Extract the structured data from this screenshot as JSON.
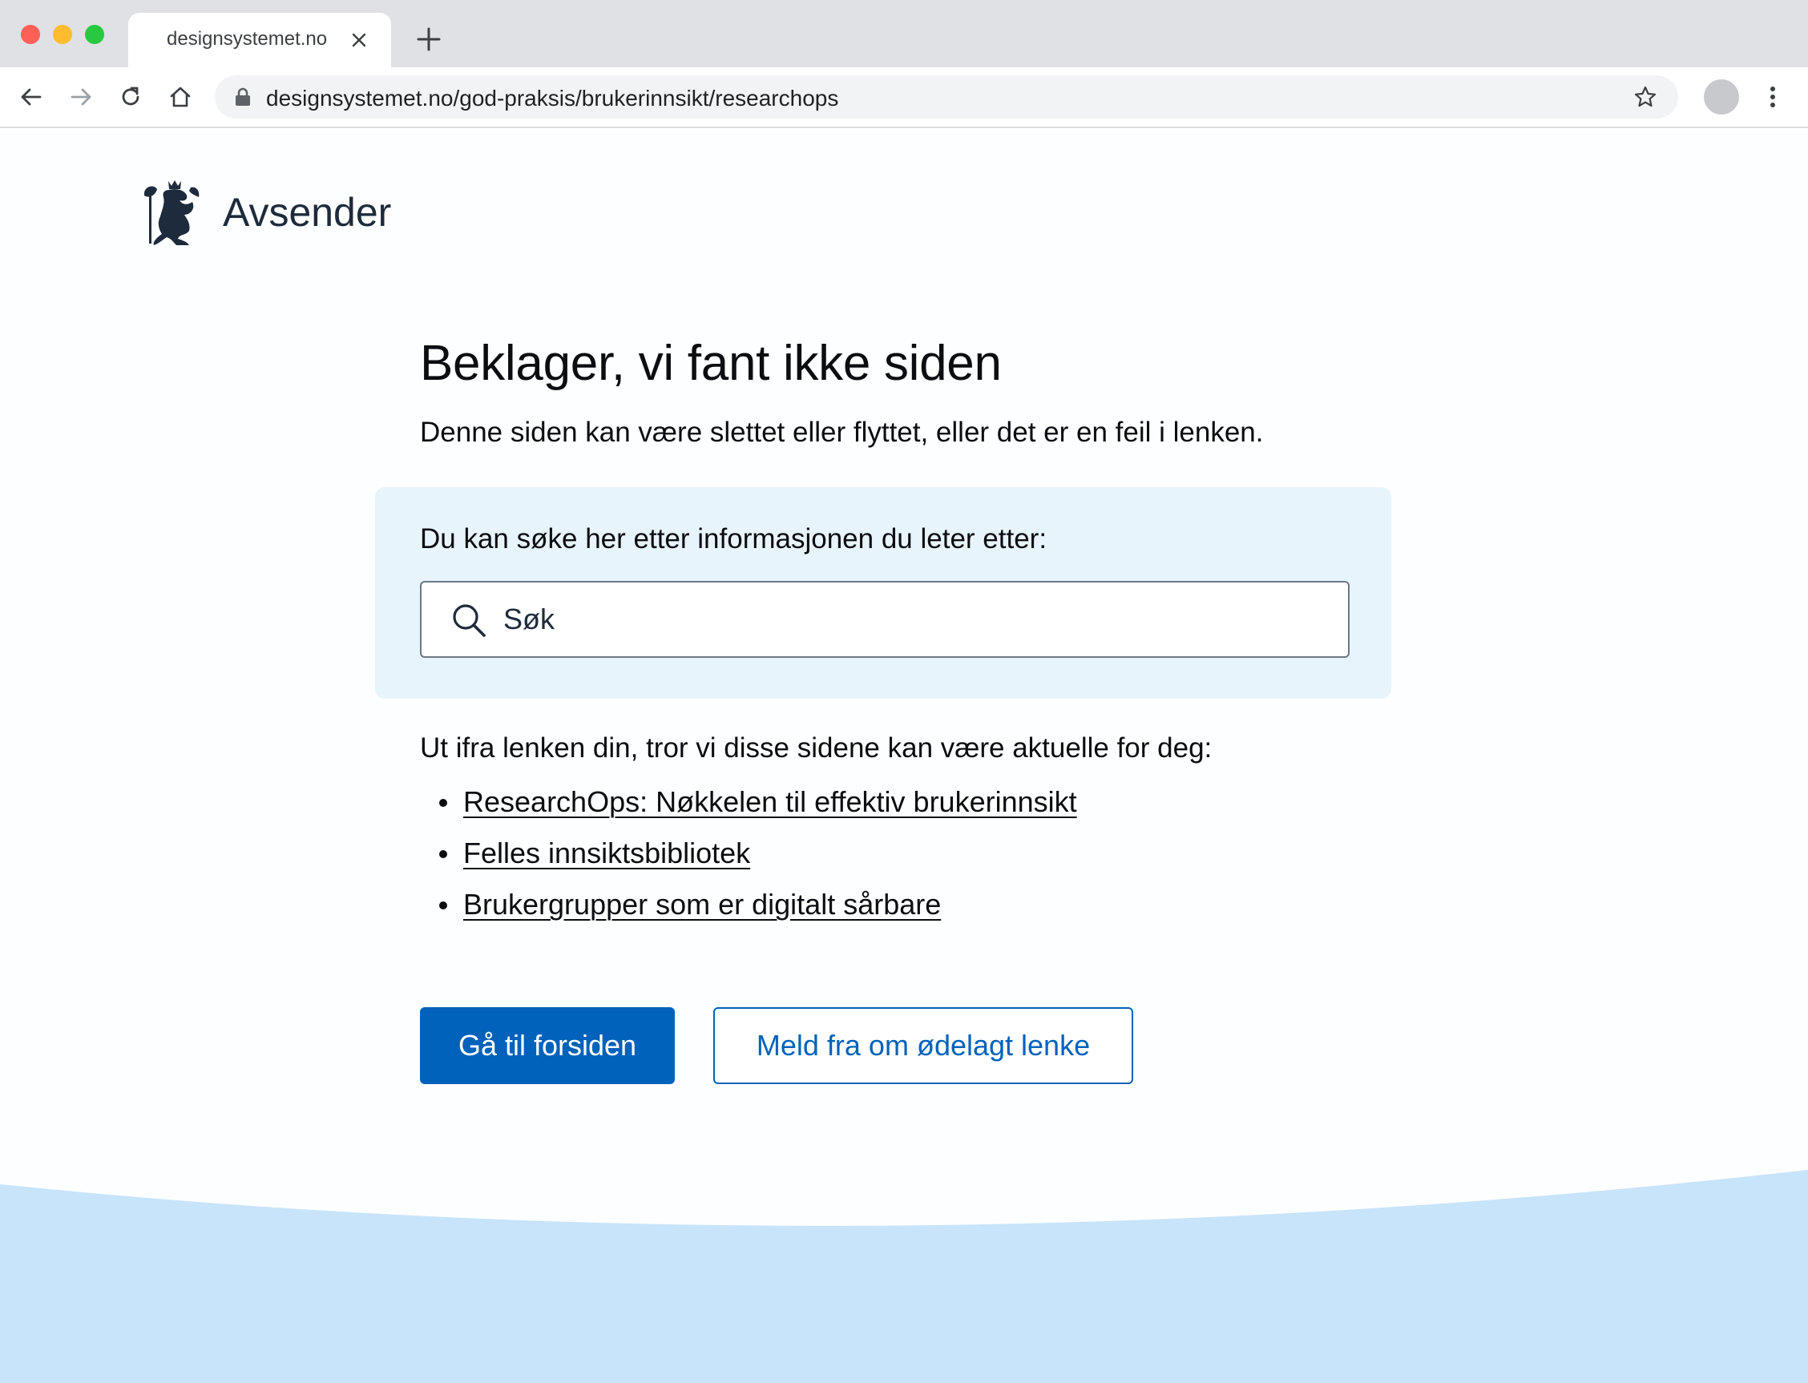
{
  "browser": {
    "tab_title": "designsystemet.no",
    "url": "designsystemet.no/god-praksis/brukerinnsikt/researchops",
    "icons": [
      "close-icon",
      "plus-icon",
      "back-arrow-icon",
      "forward-arrow-icon",
      "reload-icon",
      "home-icon",
      "lock-icon",
      "star-icon",
      "menu-dots-icon"
    ]
  },
  "header": {
    "sender_name": "Avsender",
    "logo_icon": "coat-of-arms-lion-icon"
  },
  "main": {
    "heading": "Beklager, vi fant ikke siden",
    "subtitle": "Denne siden kan være slettet eller flyttet, eller det er en feil i lenken.",
    "search": {
      "label": "Du kan søke her etter informasjonen du leter etter:",
      "placeholder": "Søk",
      "value": ""
    },
    "suggestions_intro": "Ut ifra lenken din, tror vi disse sidene kan være aktuelle for deg:",
    "suggested_links": [
      "ResearchOps: Nøkkelen til effektiv brukerinnsikt",
      "Felles innsiktsbibliotek",
      "Brukergrupper som er digitalt sårbare"
    ],
    "primary_button": "Gå til forsiden",
    "secondary_button": "Meld fra om ødelagt lenke"
  },
  "colors": {
    "accent": "#0062ba",
    "search_panel_bg": "#e8f4fc",
    "footer_wave": "#c7e4fb",
    "text": "#0b0d10"
  }
}
